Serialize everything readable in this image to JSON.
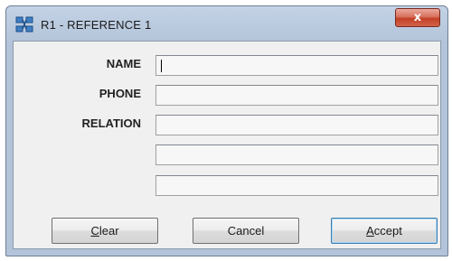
{
  "window": {
    "title": "R1 - REFERENCE 1",
    "close_glyph": "x",
    "icon": "app-network-icon"
  },
  "form": {
    "fields": [
      {
        "label": "NAME",
        "value": ""
      },
      {
        "label": "PHONE",
        "value": ""
      },
      {
        "label": "RELATION",
        "value": ""
      },
      {
        "label": "",
        "value": ""
      },
      {
        "label": "",
        "value": ""
      }
    ]
  },
  "buttons": {
    "clear": {
      "mnemonic": "C",
      "rest": "lear"
    },
    "cancel": {
      "label": "Cancel"
    },
    "accept": {
      "mnemonic": "A",
      "rest": "ccept"
    }
  },
  "colors": {
    "frame": "#b3c3d9",
    "close": "#c23f26",
    "client": "#f0f0f0",
    "default_border": "#3c7fb1"
  }
}
